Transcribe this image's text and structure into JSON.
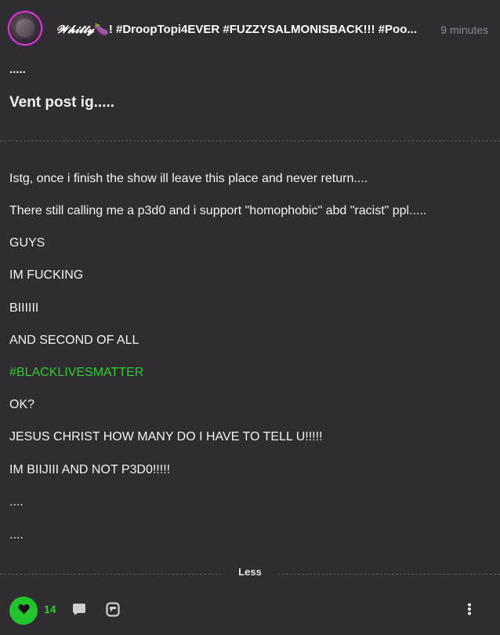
{
  "post": {
    "author_prefix": "𝓦𝓱𝓲𝓽𝓽𝔂",
    "author_emoji": "🍆",
    "author_rest": "! #DroopTopi4EVER #FUZZYSALMONISBACK!!! #Poo...",
    "time": "9 minutes",
    "pre_title": ".....",
    "title": "Vent post ig.....",
    "lines": [
      "Istg, once i finish the show ill leave this place and never return....",
      "There still calling me a p3d0 and i support \"homophobic\" abd \"racist\" ppl.....",
      "GUYS",
      "IM FUCKING",
      "BIIIIII",
      "AND SECOND OF ALL",
      "#BLACKLIVESMATTER",
      "OK?",
      "JESUS CHRIST HOW MANY DO I HAVE TO TELL U!!!!!",
      "IM BIIJIII AND NOT P3D0!!!!!",
      "....",
      "...."
    ],
    "less_label": "Less"
  },
  "footer": {
    "like_count": "14",
    "like_icon": "heart-icon",
    "comment_icon": "comment-icon",
    "share_icon": "share-icon",
    "more_icon": "more-vertical-icon"
  },
  "colors": {
    "background": "#2f2d31",
    "accent_green": "#21c42c",
    "hashtag_green": "#2ecc2e",
    "muted": "#8e8c92"
  }
}
